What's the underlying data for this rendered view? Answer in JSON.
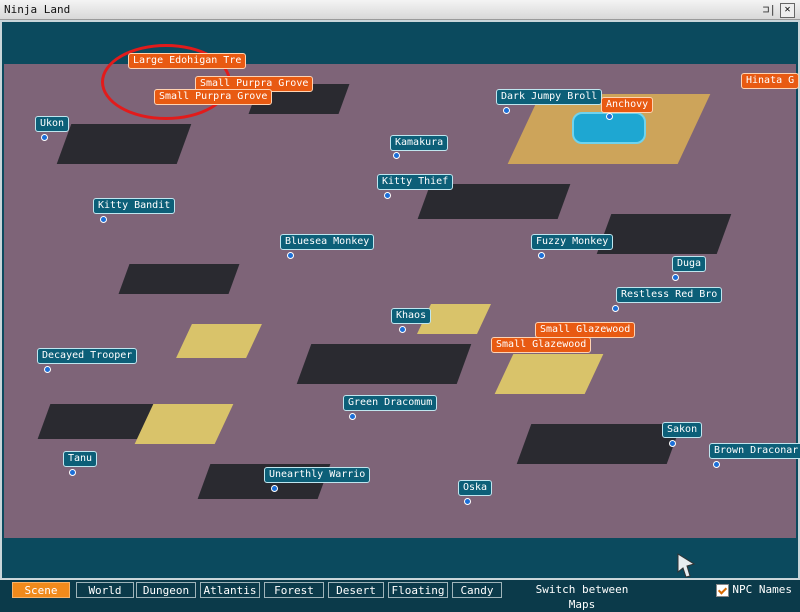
{
  "window": {
    "title": "Ninja Land",
    "pin": "⊐|",
    "close": "✕"
  },
  "labels": {
    "large_edohigan": "Large Edohigan Tre",
    "small_purpra_1": "Small Purpra Grove",
    "small_purpra_2": "Small Purpra Grove",
    "dark_jumpy": "Dark Jumpy Broll",
    "anchovy": "Anchovy",
    "hinata": "Hinata G",
    "ukon": "Ukon",
    "kamakura": "Kamakura",
    "kitty_thief": "Kitty Thief",
    "kitty_bandit": "Kitty Bandit",
    "bluesea": "Bluesea Monkey",
    "fuzzy": "Fuzzy Monkey",
    "duga": "Duga",
    "restless": "Restless Red Bro",
    "khaos": "Khaos",
    "small_glazewood_1": "Small Glazewood",
    "small_glazewood_2": "Small Glazewood",
    "decayed": "Decayed Trooper",
    "green_dracomum": "Green Dracomum",
    "sakon": "Sakon",
    "brown_draconar": "Brown Draconar",
    "tanu": "Tanu",
    "unearthly": "Unearthly Warrio",
    "oska": "Oska"
  },
  "tabs": [
    {
      "label": "Scene"
    },
    {
      "label": "World"
    },
    {
      "label": "Dungeon"
    },
    {
      "label": "Atlantis"
    },
    {
      "label": "Forest"
    },
    {
      "label": "Desert"
    },
    {
      "label": "Floating"
    },
    {
      "label": "Candy"
    }
  ],
  "switch_label": "Switch between Maps",
  "npc_names_label": "NPC Names",
  "colors": {
    "npc_label": "#0c5f78",
    "object_label": "#e85a12",
    "highlight_ring": "#e21b1b",
    "active_tab": "#f08a1c"
  }
}
